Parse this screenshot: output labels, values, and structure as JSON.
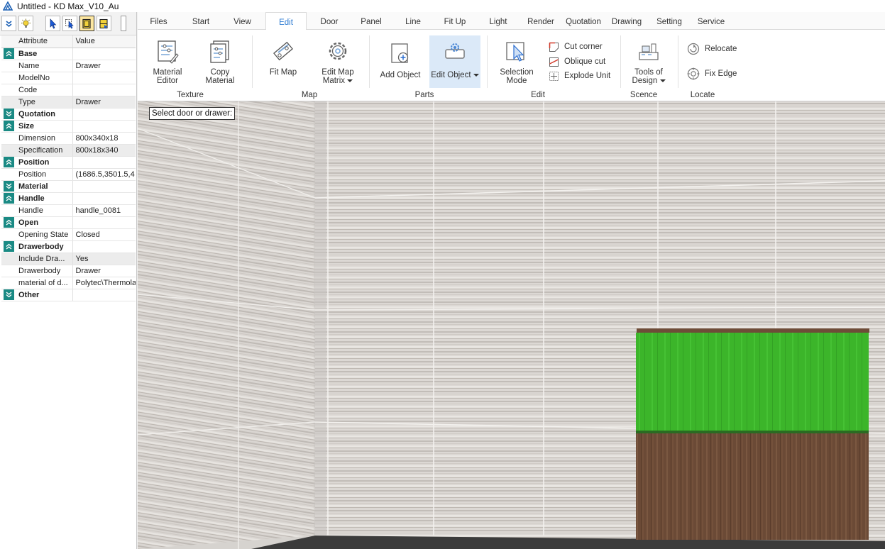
{
  "window": {
    "title": "Untitled - KD Max_V10_Au"
  },
  "left_toolbar": {
    "buttons": [
      "expand-all-icon",
      "bulb-icon",
      "select-cursor-icon",
      "multi-select-icon",
      "door-select-icon",
      "drawer-select-icon"
    ]
  },
  "properties": {
    "col_attribute": "Attribute",
    "col_value": "Value",
    "rows": [
      {
        "type": "group",
        "label": "Base",
        "state": "expanded"
      },
      {
        "type": "item",
        "label": "Name",
        "value": "Drawer"
      },
      {
        "type": "item",
        "label": "ModelNo",
        "value": ""
      },
      {
        "type": "item",
        "label": "Code",
        "value": ""
      },
      {
        "type": "item",
        "label": "Type",
        "value": "Drawer",
        "selected": true
      },
      {
        "type": "group",
        "label": "Quotation",
        "state": "collapsed"
      },
      {
        "type": "group",
        "label": "Size",
        "state": "expanded"
      },
      {
        "type": "item",
        "label": "Dimension",
        "value": "800x340x18"
      },
      {
        "type": "item",
        "label": "Specification",
        "value": "800x18x340",
        "selected": true
      },
      {
        "type": "group",
        "label": "Position",
        "state": "expanded"
      },
      {
        "type": "item",
        "label": "Position",
        "value": "(1686.5,3501.5,4"
      },
      {
        "type": "group",
        "label": "Material",
        "state": "collapsed"
      },
      {
        "type": "group",
        "label": "Handle",
        "state": "expanded"
      },
      {
        "type": "item",
        "label": "Handle",
        "value": "handle_0081"
      },
      {
        "type": "group",
        "label": "Open",
        "state": "expanded"
      },
      {
        "type": "item",
        "label": "Opening State",
        "value": "Closed"
      },
      {
        "type": "group",
        "label": "Drawerbody",
        "state": "expanded"
      },
      {
        "type": "item",
        "label": "Include Dra...",
        "value": "Yes",
        "selected": true
      },
      {
        "type": "item",
        "label": "Drawerbody",
        "value": "Drawer"
      },
      {
        "type": "item",
        "label": "material of d...",
        "value": "Polytec\\Thermola"
      },
      {
        "type": "group",
        "label": "Other",
        "state": "collapsed"
      }
    ]
  },
  "ribbon": {
    "tabs": [
      "Files",
      "Start",
      "View",
      "Edit",
      "Door",
      "Panel",
      "Line",
      "Fit Up",
      "Light",
      "Render",
      "Quotation",
      "Drawing",
      "Setting",
      "Service"
    ],
    "active_tab": "Edit",
    "groups": {
      "texture": "Texture",
      "map": "Map",
      "parts": "Parts",
      "edit": "Edit",
      "scence": "Scence",
      "locate": "Locate"
    },
    "buttons": {
      "material_editor_1": "Material",
      "material_editor_2": "Editor",
      "copy_material_1": "Copy",
      "copy_material_2": "Material",
      "fit_map": "Fit Map",
      "edit_map_matrix_1": "Edit Map",
      "edit_map_matrix_2": "Matrix",
      "add_object": "Add Object",
      "edit_object": "Edit Object",
      "selection_mode_1": "Selection",
      "selection_mode_2": "Mode",
      "cut_corner": "Cut corner",
      "oblique_cut": "Oblique cut",
      "explode_unit": "Explode Unit",
      "tools_of_design_1": "Tools of",
      "tools_of_design_2": "Design",
      "relocate": "Relocate",
      "fix_edge": "Fix Edge"
    }
  },
  "viewport": {
    "hint": "Select door or drawer:",
    "colors": {
      "drawer_front": "#3cb52a",
      "cabinet_body": "#6b4a36",
      "floor": "#3b3b3b"
    }
  }
}
